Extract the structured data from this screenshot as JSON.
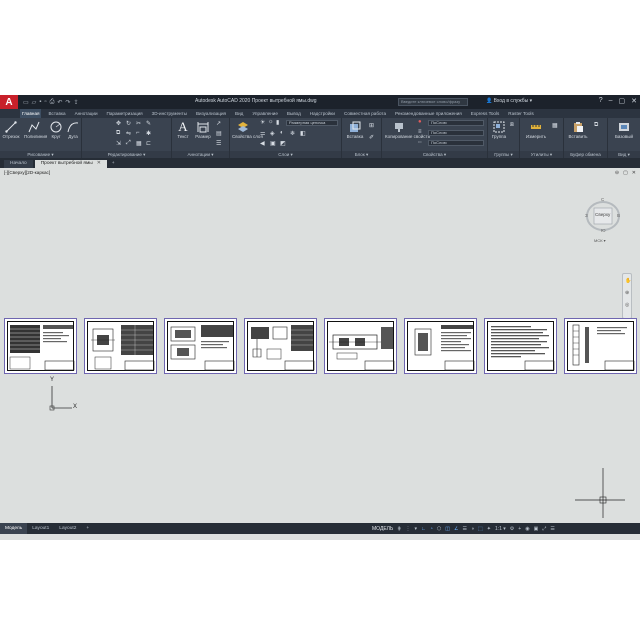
{
  "window": {
    "app_title": "Autodesk AutoCAD 2020   Проект вытребной ямы.dwg",
    "search_placeholder": "Введите ключевое слово/фразу",
    "signin": "Вход в службы ▾"
  },
  "quick_access": {
    "icons": [
      "new-file-icon",
      "open-icon",
      "save-icon",
      "save-as-icon",
      "print-icon",
      "undo-icon",
      "redo-icon"
    ]
  },
  "ribbon_tabs": [
    "Главная",
    "Вставка",
    "Аннотации",
    "Параметризация",
    "3D-инструменты",
    "Визуализация",
    "Вид",
    "Управление",
    "Вывод",
    "Надстройки",
    "Совместная работа",
    "Рекомендованные приложения",
    "Express Tools",
    "Raster Tools"
  ],
  "ribbon": {
    "draw": {
      "title": "Рисование ▾",
      "tools": [
        "Отрезок",
        "Полилиния",
        "Круг",
        "Дуга"
      ]
    },
    "modify": {
      "title": "Редактирование ▾"
    },
    "annotation": {
      "title": "Аннотации ▾",
      "tools": [
        "Текст",
        "Размер"
      ]
    },
    "layers": {
      "title": "Слои ▾",
      "tool": "Свойства слоя",
      "combo": "Размерная цепочка"
    },
    "block": {
      "title": "Блок ▾",
      "tool": "Вставка"
    },
    "properties": {
      "title": "Свойства ▾",
      "tool": "Копирование свойств",
      "combos": [
        "ПоСлою",
        "ПоСлою",
        "ПоСлою"
      ]
    },
    "groups": {
      "title": "Группы ▾",
      "tool": "Группа"
    },
    "utilities": {
      "title": "Утилиты ▾",
      "tool": "Измерить"
    },
    "clipboard": {
      "title": "Буфер обмена",
      "tool": "Вставить"
    },
    "view": {
      "title": "Вид ▾",
      "tool": "Базовый"
    }
  },
  "document_tabs": [
    {
      "label": "Начало",
      "active": false
    },
    {
      "label": "Проект вытребной ямы",
      "active": true
    }
  ],
  "drawing": {
    "view_label": "[-][Сверху][2D-каркас]",
    "viewcube": {
      "top": "Сверху",
      "north": "С",
      "south": "Ю",
      "west": "З",
      "east": "В",
      "wcs": "МСК ▾"
    },
    "ucs": {
      "x": "X",
      "y": "Y"
    },
    "sheet_count": 8
  },
  "layout_tabs": [
    {
      "label": "Модель",
      "active": true
    },
    {
      "label": "Layout1",
      "active": false
    },
    {
      "label": "Layout2",
      "active": false
    }
  ],
  "status": {
    "model_label": "МОДЕЛЬ",
    "scale": "1:1 ▾"
  }
}
